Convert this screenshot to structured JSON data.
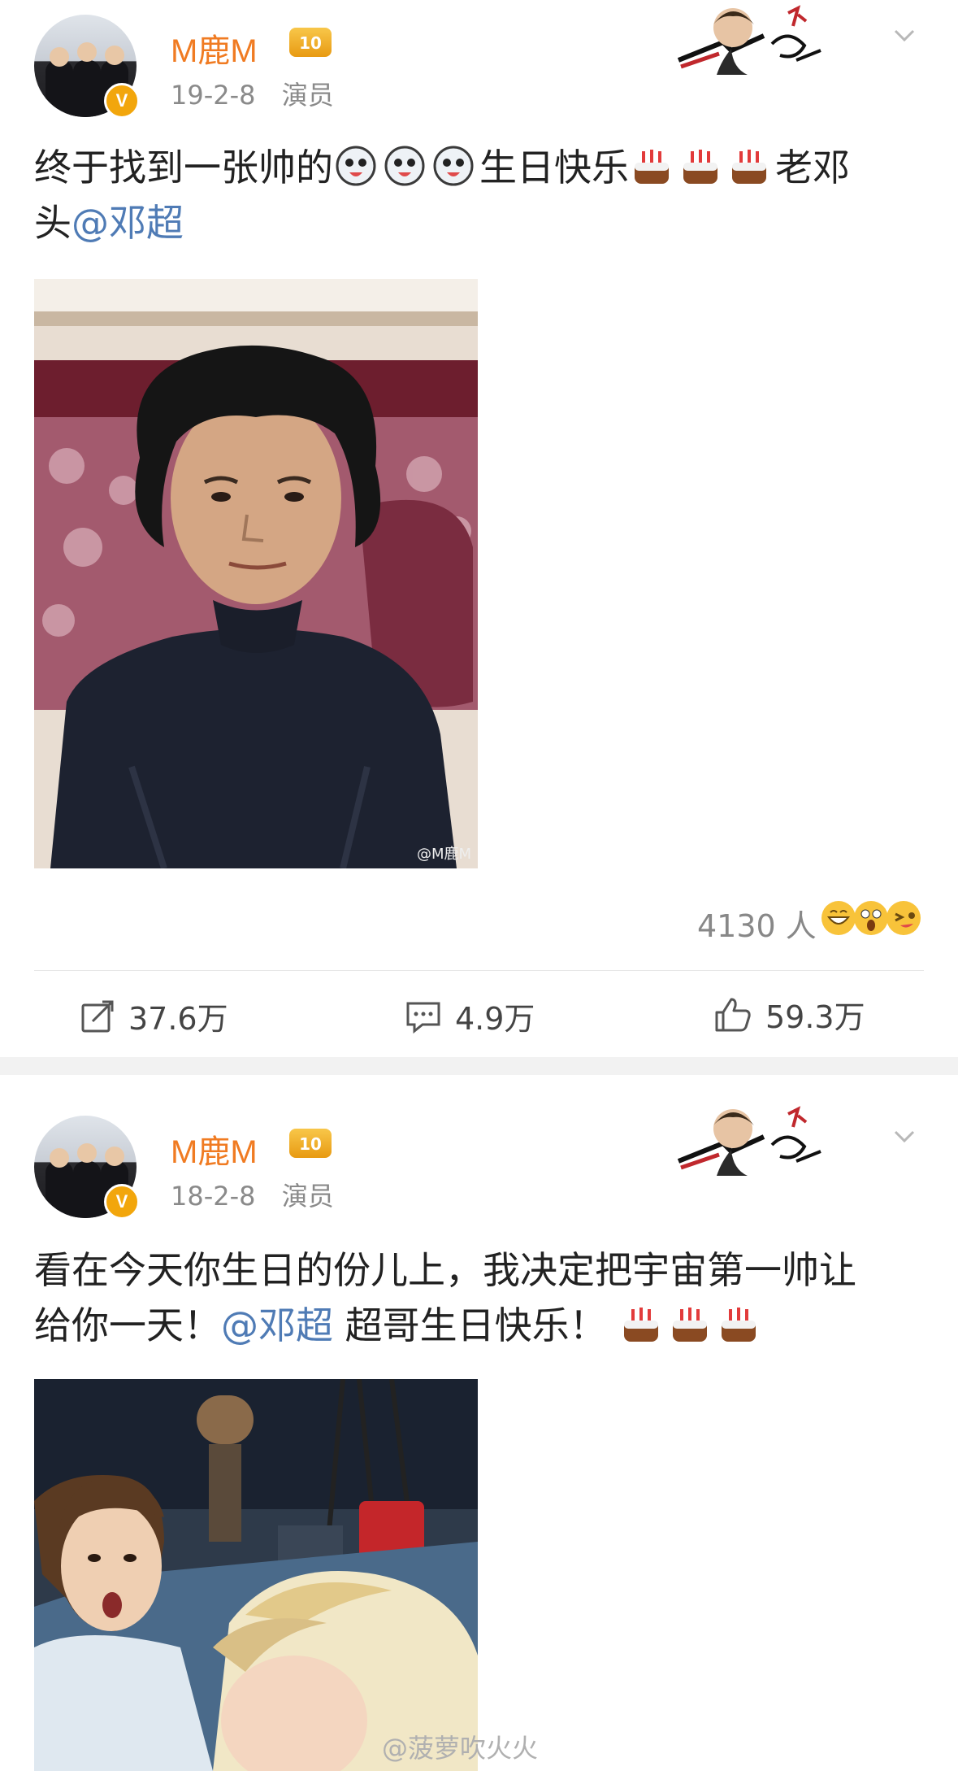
{
  "posts": [
    {
      "username": "M鹿M",
      "crown_badge": "10",
      "date": "19-2-8",
      "source": "演员",
      "text_a": "终于找到一张帅的",
      "text_b": "生日快乐",
      "text_c": "老邓",
      "text_d": "头",
      "mention": "@邓超",
      "photo_watermark": "@M鹿M",
      "reaction_count": "4130 人",
      "actions": {
        "repost": "37.6万",
        "comment": "4.9万",
        "like": "59.3万"
      }
    },
    {
      "username": "M鹿M",
      "crown_badge": "10",
      "date": "18-2-8",
      "source": "演员",
      "text_a": "看在今天你生日的份儿上，我决定把宇宙第一帅让",
      "text_b": "给你一天！",
      "mention": "@邓超",
      "text_c": " 超哥生日快乐！"
    }
  ],
  "page_watermark": "@菠萝吹火火",
  "icons": [
    "verified-v-icon",
    "crown-badge-icon",
    "chevron-down-icon",
    "repost-icon",
    "comment-icon",
    "like-icon",
    "doge-emoji-icon",
    "cake-emoji-icon"
  ],
  "colors": {
    "username": "#f07b22",
    "mention": "#4f7bb5",
    "meta": "#8a8a8a"
  }
}
